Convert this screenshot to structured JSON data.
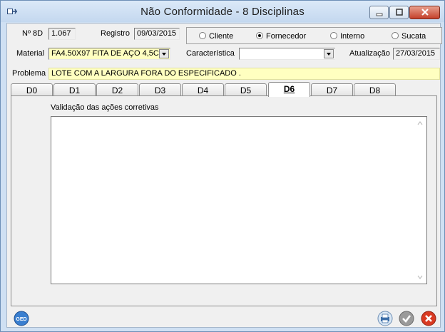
{
  "window": {
    "title": "Não Conformidade - 8 Disciplinas"
  },
  "header": {
    "n8d_label": "Nº 8D",
    "n8d_value": "1.067",
    "registro_label": "Registro",
    "registro_value": "09/03/2015",
    "radios": [
      {
        "label": "Cliente",
        "selected": false
      },
      {
        "label": "Fornecedor",
        "selected": true
      },
      {
        "label": "Interno",
        "selected": false
      },
      {
        "label": "Sucata",
        "selected": false
      }
    ],
    "material_label": "Material",
    "material_value": "FA4.50X97  FITA DE AÇO 4,5C",
    "caracteristica_label": "Característica",
    "caracteristica_value": "",
    "atualizacao_label": "Atualização",
    "atualizacao_value": "27/03/2015",
    "problema_label": "Problema",
    "problema_value": "LOTE COM A LARGURA FORA DO ESPECIFICADO  ."
  },
  "tabs": [
    {
      "label": "D0",
      "active": false
    },
    {
      "label": "D1",
      "active": false
    },
    {
      "label": "D2",
      "active": false
    },
    {
      "label": "D3",
      "active": false
    },
    {
      "label": "D4",
      "active": false
    },
    {
      "label": "D5",
      "active": false
    },
    {
      "label": "D6",
      "active": true
    },
    {
      "label": "D7",
      "active": false
    },
    {
      "label": "D8",
      "active": false
    }
  ],
  "panel": {
    "memo_label": "Validação das ações corretivas",
    "memo_value": ""
  },
  "footer": {
    "ged_label": "GED",
    "icons": [
      "ged-icon",
      "print-icon",
      "confirm-check-icon",
      "cancel-x-icon"
    ]
  },
  "colors": {
    "field_highlight": "#ffffc0",
    "cancel": "#d93a22",
    "confirm": "#7a7a7a"
  }
}
